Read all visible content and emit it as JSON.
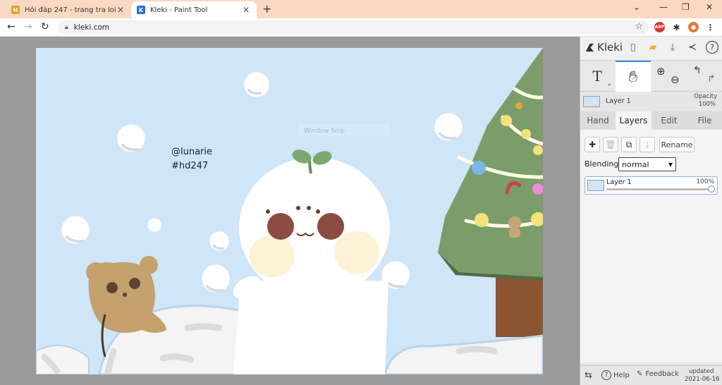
{
  "browser": {
    "tabs": [
      {
        "title": "Hỏi đáp 247 - trang tra loi",
        "active": false,
        "favicon_color": "#e8a320"
      },
      {
        "title": "Kleki - Paint Tool",
        "active": true,
        "favicon_color": "#2a6fd6"
      }
    ],
    "url": "kleki.com",
    "new_tab_symbol": "+"
  },
  "canvas": {
    "watermark_text_1": "@lunarie",
    "watermark_text_2": "#hd247",
    "overlay_text": "Window Snip"
  },
  "sidebar": {
    "app_name": "Kleki",
    "layer_preview_name": "Layer 1",
    "opacity_label": "Opacity",
    "opacity_value": "100%",
    "tabs": [
      "Hand",
      "Layers",
      "Edit",
      "File"
    ],
    "active_tab": "Layers",
    "rename_label": "Rename",
    "blending_label": "Blending",
    "blending_value": "normal",
    "layer": {
      "name": "Layer 1",
      "opacity": "100%"
    },
    "bottom": {
      "help_label": "Help",
      "feedback_label": "Feedback",
      "updated_label": "updated",
      "updated_date": "2021-06-16"
    }
  },
  "icons": {
    "text_tool": "text-tool-icon",
    "hand_tool": "hand-tool-icon",
    "zoom_in": "zoom-in-icon",
    "zoom_out": "zoom-out-icon",
    "undo": "undo-icon",
    "redo": "redo-icon"
  },
  "colors": {
    "tab_bar": "#f9d9c3",
    "canvas_bg": "#cfe5f8",
    "accent": "#3b8fd8"
  }
}
